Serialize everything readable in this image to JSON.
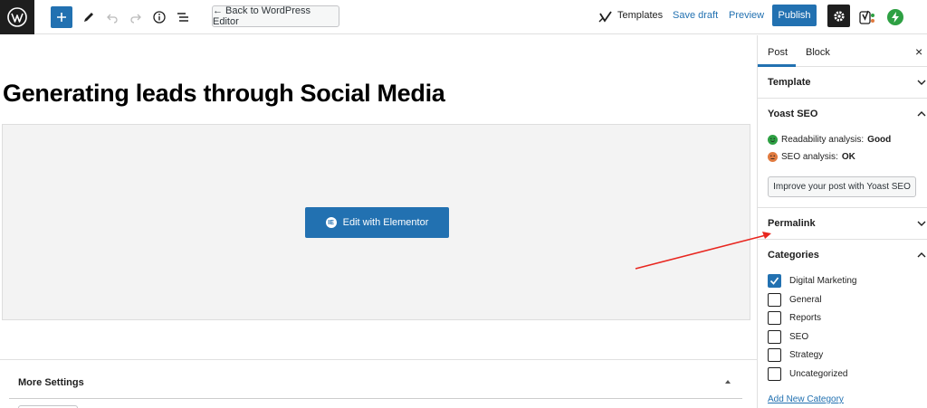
{
  "toolbar": {
    "back_label": "← Back to WordPress Editor",
    "templates_label": "Templates",
    "save_draft_label": "Save draft",
    "preview_label": "Preview",
    "publish_label": "Publish"
  },
  "editor": {
    "post_title": "Generating leads through Social Media",
    "elementor_button_label": "Edit with Elementor",
    "elementor_badge": "IE",
    "more_settings_label": "More Settings"
  },
  "sidebar": {
    "tabs": [
      {
        "label": "Post",
        "active": true
      },
      {
        "label": "Block",
        "active": false
      }
    ],
    "close_symbol": "×",
    "panels": {
      "template": {
        "title": "Template"
      },
      "yoast": {
        "title": "Yoast SEO",
        "readability_label": "Readability analysis:",
        "readability_value": "Good",
        "seo_label": "SEO analysis:",
        "seo_value": "OK",
        "improve_button": "Improve your post with Yoast SEO"
      },
      "permalink": {
        "title": "Permalink"
      },
      "categories": {
        "title": "Categories",
        "items": [
          {
            "label": "Digital Marketing",
            "checked": true
          },
          {
            "label": "General",
            "checked": false
          },
          {
            "label": "Reports",
            "checked": false
          },
          {
            "label": "SEO",
            "checked": false
          },
          {
            "label": "Strategy",
            "checked": false
          },
          {
            "label": "Uncategorized",
            "checked": false
          }
        ],
        "add_new_label": "Add New Category"
      }
    }
  },
  "colors": {
    "accent": "#2271b1",
    "good": "#2ea043",
    "ok": "#e07a3f",
    "annotation_arrow": "#e8261f",
    "dark": "#1e1e1e"
  }
}
